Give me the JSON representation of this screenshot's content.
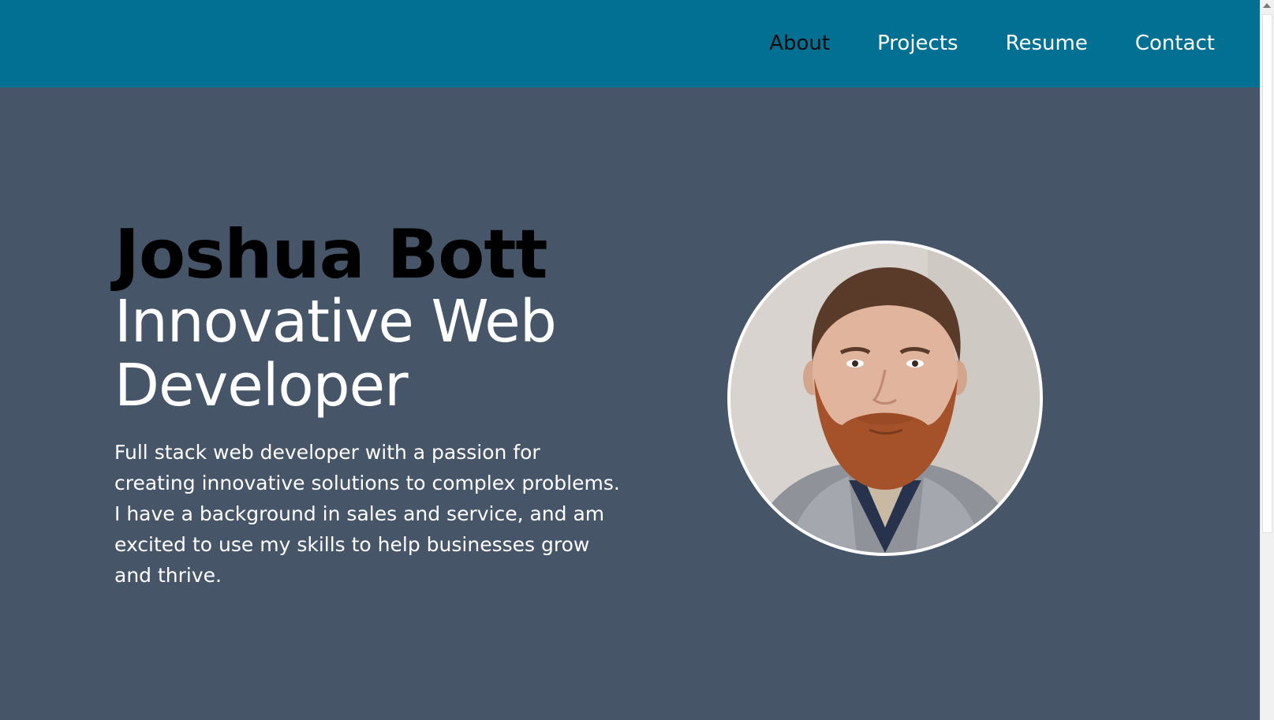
{
  "nav": {
    "items": [
      {
        "label": "About",
        "active": true
      },
      {
        "label": "Projects",
        "active": false
      },
      {
        "label": "Resume",
        "active": false
      },
      {
        "label": "Contact",
        "active": false
      }
    ]
  },
  "hero": {
    "name": "Joshua Bott",
    "role": "Innovative Web Developer",
    "description": "Full stack web developer with a passion for creating innovative solutions to complex problems. I have a background in sales and service, and am excited to use my skills to help businesses grow and thrive."
  },
  "colors": {
    "navbar": "#027092",
    "background": "#475569",
    "active_nav": "#0b0b0b",
    "text": "#ffffff",
    "heading": "#000000"
  },
  "icons": {
    "avatar": "profile-photo",
    "scroll_up": "scroll-up-arrow"
  }
}
